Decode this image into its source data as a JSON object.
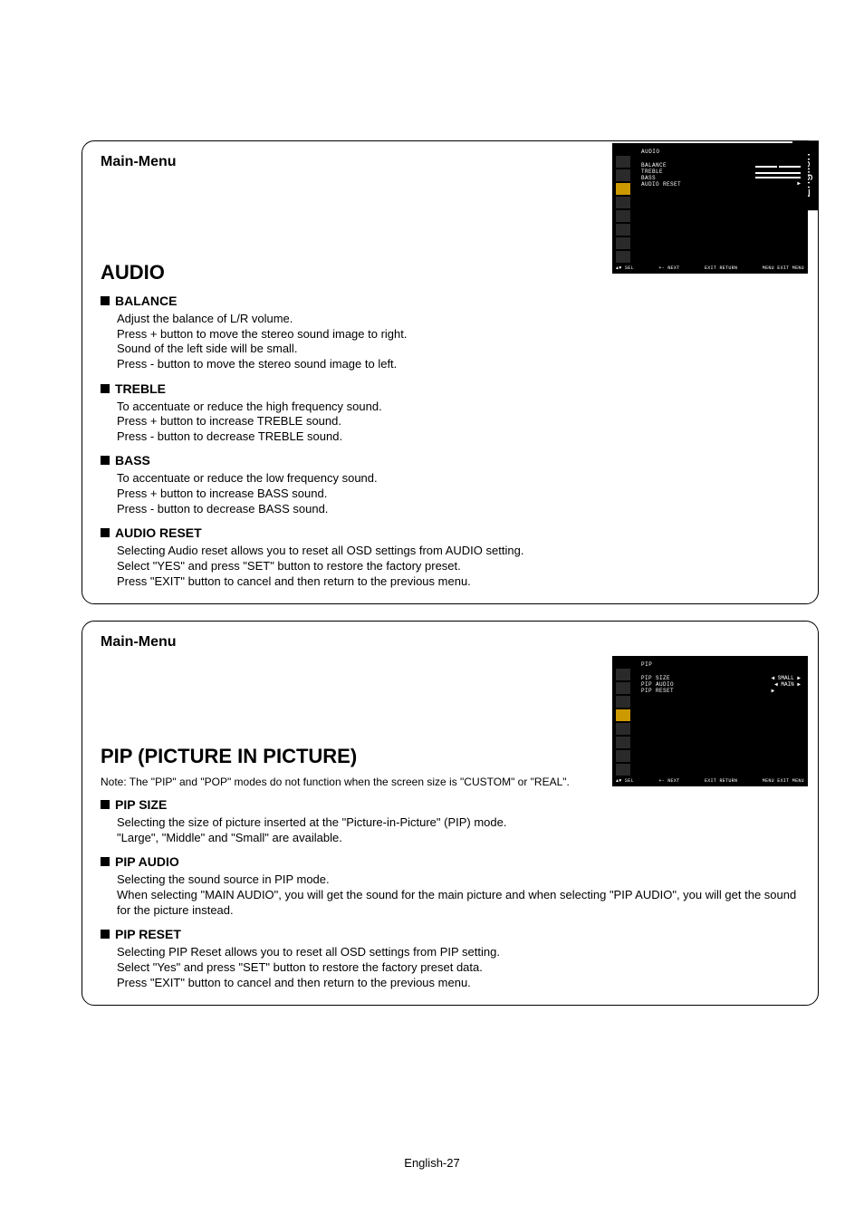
{
  "language_tab": "English",
  "page_number": "English-27",
  "panels": [
    {
      "mainmenu": "Main-Menu",
      "title": "AUDIO",
      "note": "",
      "items": [
        {
          "head": "BALANCE",
          "body": "Adjust the balance of L/R volume.\nPress + button to move the stereo sound image to right.\nSound of the left side will be small.\nPress - button to move the stereo sound image to left."
        },
        {
          "head": "TREBLE",
          "body": "To accentuate or reduce the high frequency sound.\nPress + button to increase TREBLE sound.\nPress - button to decrease TREBLE sound."
        },
        {
          "head": "BASS",
          "body": "To accentuate or reduce the low frequency sound.\nPress + button to increase BASS sound.\nPress - button to decrease BASS sound."
        },
        {
          "head": "AUDIO RESET",
          "body": "Selecting Audio reset allows you to reset all OSD settings from AUDIO setting.\nSelect \"YES\" and press \"SET\" button to restore the factory preset.\nPress \"EXIT\" button to cancel and then return to the previous menu."
        }
      ]
    },
    {
      "mainmenu": "Main-Menu",
      "title": "PIP (PICTURE IN PICTURE)",
      "note": "Note: The \"PIP\" and \"POP\" modes do not function when the screen size is \"CUSTOM\" or \"REAL\".",
      "items": [
        {
          "head": "PIP SIZE",
          "body": "Selecting the size of picture inserted at the \"Picture-in-Picture\" (PIP) mode.\n\"Large\", \"Middle\" and \"Small\" are available."
        },
        {
          "head": "PIP AUDIO",
          "body": "Selecting the sound source in PIP mode.\nWhen selecting \"MAIN AUDIO\", you will get the sound for the main picture and when selecting \"PIP AUDIO\", you will get the sound for the picture instead."
        },
        {
          "head": "PIP RESET",
          "body": "Selecting PIP Reset allows you to reset all OSD settings from PIP setting.\nSelect \"Yes\" and press \"SET\" button to restore the factory preset data.\nPress \"EXIT\" button to cancel and then return to the previous menu."
        }
      ]
    }
  ],
  "osd": [
    {
      "title": "AUDIO",
      "menu": [
        "BALANCE",
        "TREBLE",
        "BASS",
        "AUDIO RESET"
      ],
      "values_type": "sliders",
      "values": [
        "",
        "",
        "",
        "▶"
      ],
      "footer": [
        "▲▼ SEL",
        "+- NEXT",
        "EXIT RETURN",
        "MENU EXIT MENU"
      ]
    },
    {
      "title": "PIP",
      "menu": [
        "PIP SIZE",
        "PIP AUDIO",
        "PIP RESET"
      ],
      "values_type": "text",
      "values": [
        "◀ SMALL ▶",
        "◀ MAIN  ▶",
        "▶"
      ],
      "footer": [
        "▲▼ SEL",
        "+- NEXT",
        "EXIT RETURN",
        "MENU EXIT MENU"
      ]
    }
  ]
}
